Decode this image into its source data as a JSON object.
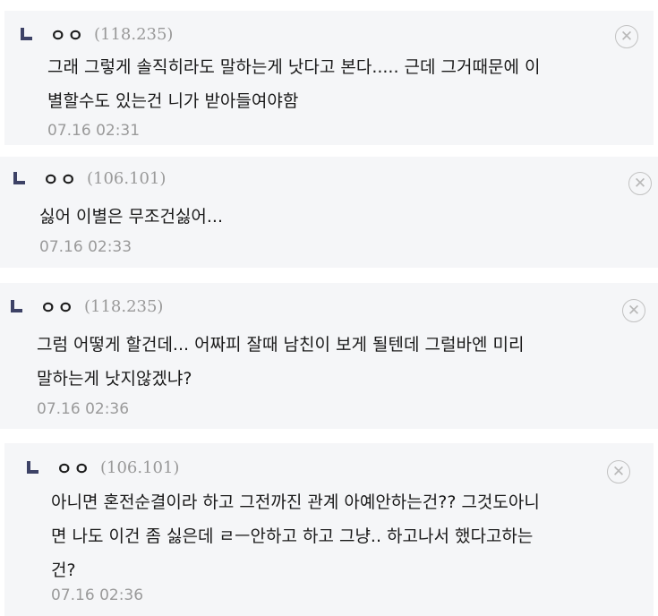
{
  "comments": [
    {
      "nick": "ㅇㅇ",
      "ip": "(118.235)",
      "lines": [
        "그래 그렇게 솔직히라도 말하는게 낫다고 본다..... 근데 그거때문에 이",
        "별할수도 있는건 니가 받아들여야함"
      ],
      "date": "07.16 02:31",
      "delete_icon": "close-circle-icon"
    },
    {
      "nick": "ㅇㅇ",
      "ip": "(106.101)",
      "lines": [
        "싫어 이별은 무조건싫어..."
      ],
      "date": "07.16 02:33",
      "delete_icon": "close-circle-icon"
    },
    {
      "nick": "ㅇㅇ",
      "ip": "(118.235)",
      "lines": [
        "그럼 어떻게 할건데... 어짜피 잘때 남친이 보게 될텐데 그럴바엔 미리",
        "말하는게 낫지않겠냐?"
      ],
      "date": "07.16 02:36",
      "delete_icon": "close-circle-icon"
    },
    {
      "nick": "ㅇㅇ",
      "ip": "(106.101)",
      "lines": [
        "아니면 혼전순결이라 하고 그전까진 관계 아예안하는건?? 그것도아니",
        "면 나도 이건 좀 싫은데 ㄹㅡ안하고 하고 그냥.. 하고나서 했다고하는",
        "건?"
      ],
      "date": "07.16 02:36",
      "delete_icon": "close-circle-icon"
    }
  ]
}
